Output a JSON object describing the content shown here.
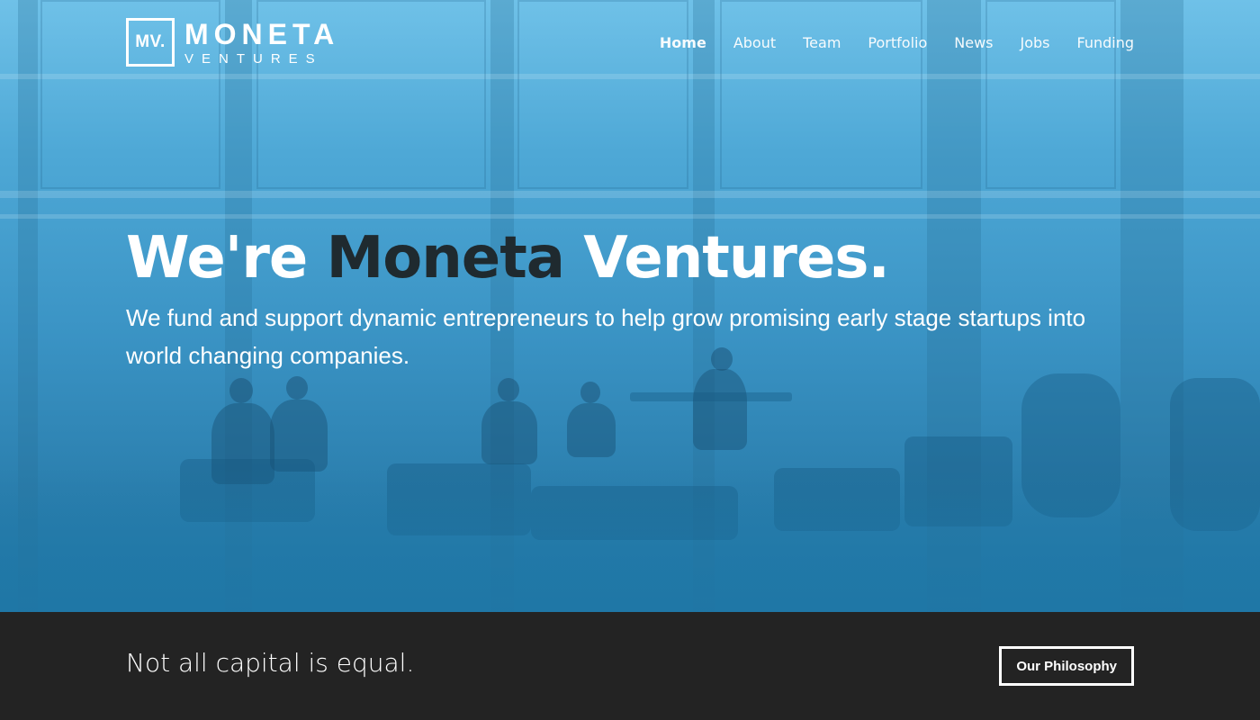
{
  "brand": {
    "monogram": "MV.",
    "name_line1": "MONETA",
    "name_line2": "VENTURES"
  },
  "nav": {
    "items": [
      {
        "label": "Home",
        "active": true
      },
      {
        "label": "About",
        "active": false
      },
      {
        "label": "Team",
        "active": false
      },
      {
        "label": "Portfolio",
        "active": false
      },
      {
        "label": "News",
        "active": false
      },
      {
        "label": "Jobs",
        "active": false
      },
      {
        "label": "Funding",
        "active": false
      }
    ]
  },
  "hero": {
    "headline_part1": "We're ",
    "headline_part2": "Moneta",
    "headline_part3": " Ventures.",
    "subheadline": "We fund and support dynamic entrepreneurs to help grow promising early stage startups into world changing companies."
  },
  "band": {
    "tagline": "Not all capital is equal.",
    "cta_label": "Our Philosophy"
  },
  "colors": {
    "hero_overlay": "#3a93c4",
    "headline_accent": "#1f2a2f",
    "band_background": "#232323"
  }
}
